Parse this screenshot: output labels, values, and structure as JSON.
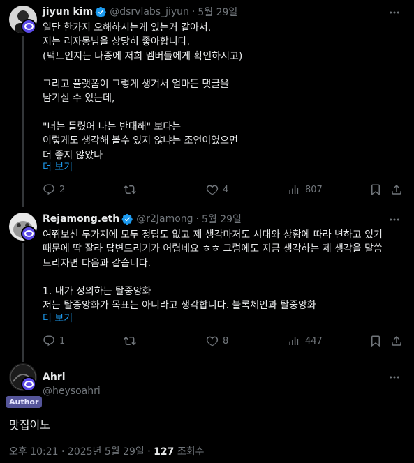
{
  "tweets": [
    {
      "name": "jiyun kim",
      "handle": "@dsrvlabs_jiyun",
      "date": "5월 29일",
      "text": "일단 한가지 오해하시는게 있는거 같아서.\n저는 리자몽님을 상당히 좋아합니다.\n(팩트인지는 나중에 저희 멤버들에게 확인하시고)\n\n그리고 플랫폼이 그렇게 생겨서 얼마든 댓글을\n남기실 수 있는데,\n\n\"너는 틀렸어 나는 반대해\" 보다는\n이렇게도 생각해 볼수 있지 않냐는 조언이였으면\n더 좋지 않았나",
      "more": "더 보기",
      "replies": "2",
      "reposts": "",
      "likes": "4",
      "views": "807"
    },
    {
      "name": "Rejamong.eth",
      "handle": "@r2Jamong",
      "date": "5월 29일",
      "text": "여쭤보신 두가지에 모두 정답도 없고 제 생각마저도 시대와 상황에 따라 변하고 있기\n때문에 딱 잘라 답변드리기가 어렵네요 ㅎㅎ 그럼에도 지금 생각하는 제 생각을 말씀\n드리자면 다음과 같습니다.\n\n1. 내가 정의하는 탈중앙화\n저는 탈중앙화가 목표는 아니라고 생각합니다. 블록체인과 탈중앙화",
      "more": "더 보기",
      "replies": "1",
      "reposts": "",
      "likes": "8",
      "views": "447"
    }
  ],
  "main": {
    "name": "Ahri",
    "handle": "@heysoahri",
    "author_tag": "Author",
    "text": "맛집이노",
    "time": "오후 10:21 · 2025년 5월 29일 · ",
    "views": "127",
    "views_label": " 조회수"
  },
  "colors": {
    "accent": "#1d9bf0",
    "muted": "#71767b",
    "author_tag_bg": "#55559a",
    "badge": "#5b4ae8"
  }
}
